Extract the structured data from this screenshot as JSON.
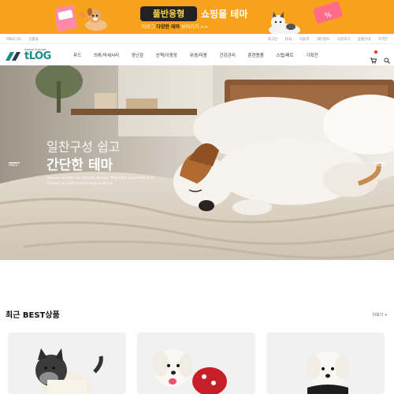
{
  "promo": {
    "pill": "풀반응형",
    "title": "쇼핑몰 테마",
    "sub_prefix": "티로그",
    "sub_bold": "다양한 테마",
    "sub_suffix": "보러가기 >>"
  },
  "util": {
    "left": [
      "PREV 01",
      "상품들"
    ],
    "right": [
      "로그인",
      "FAQ",
      "이용약",
      "개인정보",
      "사용하기",
      "상품안내",
      "가격안"
    ]
  },
  "header": {
    "logo_word": "tLOG",
    "logo_tagline": "license & plugin",
    "nav": [
      "푸드",
      "의류/악세서리",
      "장난감",
      "산책/이동장",
      "위생/미용",
      "건강관리",
      "훈련용품",
      "스텝/매트",
      "기획전"
    ]
  },
  "hero": {
    "line1": "일찬구성 쉽고",
    "line2": "간단한 테마",
    "desc": "Aenean auctor nec rutrum ultrices. Phasellus imperdiet a ut id eros, id amet ornare mauris et nisi",
    "prev": "PREV",
    "next": "NEXT"
  },
  "best": {
    "title": "최근 BEST상품",
    "more": "더보기 +"
  },
  "colors": {
    "promo_bg": "#f7a21b",
    "brand": "#1b8a8a"
  }
}
